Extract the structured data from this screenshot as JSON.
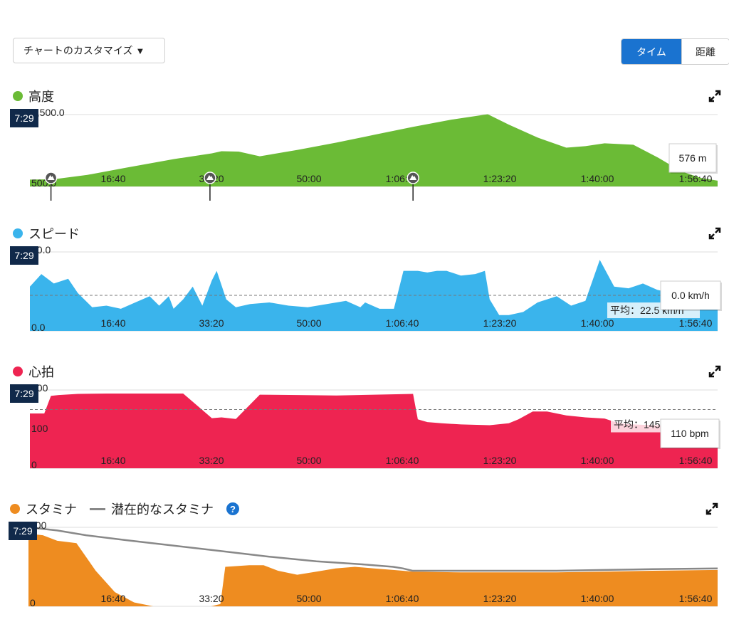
{
  "toolbar": {
    "customize_label": "チャートのカスタマイズ",
    "customize_arrow": "▼",
    "toggle_time": "タイム",
    "toggle_distance": "距離"
  },
  "icons": {
    "expand": "expand-icon",
    "help": "help-icon",
    "summit": "summit-marker-icon"
  },
  "chart_data": [
    {
      "id": "elevation",
      "title": "高度",
      "type": "area",
      "color": "#6bbb36",
      "cursor_label": "7:29",
      "ylim": [
        500,
        1500
      ],
      "y_tick_labels": [
        "1,500.0",
        "500.0"
      ],
      "x_tick_labels": [
        "16:40",
        "33:20",
        "50:00",
        "1:06:40",
        "1:23:20",
        "1:40:00",
        "1:56:40"
      ],
      "x_unit": "seconds",
      "xlim": [
        0,
        7180
      ],
      "x": [
        0,
        250,
        600,
        1000,
        1500,
        1900,
        2000,
        2180,
        2400,
        2800,
        3200,
        3600,
        4000,
        4400,
        4780,
        5000,
        5300,
        5600,
        5800,
        6000,
        6300,
        6560,
        6800,
        7000,
        7180
      ],
      "values": [
        595,
        600,
        660,
        760,
        880,
        960,
        990,
        985,
        920,
        1010,
        1110,
        1220,
        1330,
        1430,
        1505,
        1360,
        1180,
        1040,
        1060,
        1100,
        1080,
        900,
        710,
        620,
        580
      ],
      "markers_x": [
        220,
        1880,
        4000
      ],
      "tooltip": "576 m"
    },
    {
      "id": "speed",
      "title": "スピード",
      "type": "area",
      "color": "#3ab4ec",
      "cursor_label": "7:29",
      "ylim": [
        0,
        50
      ],
      "y_tick_labels": [
        "50.0",
        "0.0"
      ],
      "x_tick_labels": [
        "16:40",
        "33:20",
        "50:00",
        "1:06:40",
        "1:23:20",
        "1:40:00",
        "1:56:40"
      ],
      "x_unit": "seconds",
      "xlim": [
        0,
        7180
      ],
      "x": [
        0,
        120,
        250,
        400,
        500,
        650,
        800,
        950,
        1100,
        1250,
        1350,
        1450,
        1500,
        1600,
        1700,
        1800,
        1900,
        1950,
        2050,
        2150,
        2300,
        2500,
        2700,
        2900,
        3100,
        3300,
        3450,
        3500,
        3650,
        3800,
        3900,
        4000,
        4050,
        4150,
        4250,
        4350,
        4500,
        4650,
        4750,
        4800,
        4900,
        5000,
        5150,
        5300,
        5500,
        5650,
        5800,
        5950,
        6100,
        6250,
        6400,
        6550,
        6700,
        6900,
        7050,
        7180
      ],
      "values": [
        28,
        36,
        30,
        33,
        24,
        15,
        16,
        14,
        18,
        22,
        16,
        22,
        14,
        20,
        28,
        16,
        32,
        38,
        20,
        15,
        17,
        18,
        16,
        15,
        17,
        19,
        15,
        18,
        14,
        14,
        38,
        38,
        38,
        37,
        38,
        38,
        35,
        36,
        38,
        20,
        10,
        10,
        12,
        18,
        22,
        16,
        19,
        45,
        28,
        27,
        30,
        26,
        24,
        28,
        24,
        14
      ],
      "avg_line": 22.5,
      "avg_label": "平均：22.5 km/h",
      "tooltip": "0.0 km/h"
    },
    {
      "id": "heart_rate",
      "title": "心拍",
      "type": "area",
      "color": "#ee2451",
      "cursor_label": "7:29",
      "ylim": [
        0,
        200
      ],
      "y_tick_labels": [
        "200",
        "100",
        "0"
      ],
      "x_tick_labels": [
        "16:40",
        "33:20",
        "50:00",
        "1:06:40",
        "1:23:20",
        "1:40:00",
        "1:56:40"
      ],
      "x_unit": "seconds",
      "xlim": [
        0,
        7180
      ],
      "x": [
        0,
        150,
        220,
        300,
        500,
        800,
        1200,
        1600,
        1700,
        1900,
        2000,
        2150,
        2400,
        2800,
        3200,
        3600,
        4000,
        4050,
        4150,
        4300,
        4500,
        4800,
        5000,
        5100,
        5250,
        5400,
        5600,
        5800,
        6000,
        6150,
        6300,
        6500,
        6800,
        7000,
        7180
      ],
      "values": [
        140,
        140,
        185,
        187,
        190,
        191,
        191,
        191,
        170,
        128,
        130,
        126,
        188,
        187,
        186,
        188,
        190,
        125,
        118,
        115,
        112,
        110,
        115,
        125,
        145,
        145,
        135,
        130,
        127,
        115,
        112,
        110,
        108,
        108,
        108
      ],
      "avg_line": 150,
      "avg_label": "平均：145 bpm",
      "tooltip": "110 bpm"
    },
    {
      "id": "stamina",
      "title": "スタミナ",
      "secondary_title": "潜在的なスタミナ",
      "type": "area",
      "color": "#ee8c20",
      "secondary_color": "#888888",
      "cursor_label": "7:29",
      "ylim": [
        0,
        100
      ],
      "y_tick_labels": [
        "100",
        "0"
      ],
      "x_tick_labels": [
        "16:40",
        "33:20",
        "50:00",
        "1:06:40",
        "1:23:20",
        "1:40:00",
        "1:56:40"
      ],
      "x_unit": "seconds",
      "xlim": [
        0,
        7180
      ],
      "x": [
        0,
        150,
        300,
        500,
        700,
        900,
        1100,
        1300,
        1600,
        1900,
        2000,
        2050,
        2300,
        2450,
        2600,
        2800,
        3000,
        3200,
        3400,
        3600,
        3800,
        3900,
        4000,
        4500,
        5000,
        5500,
        6000,
        6500,
        7180
      ],
      "values": [
        92,
        90,
        83,
        80,
        45,
        18,
        5,
        0,
        0,
        0,
        3,
        50,
        52,
        52,
        45,
        40,
        44,
        48,
        50,
        48,
        46,
        45,
        44,
        43,
        43,
        43,
        44,
        45,
        46
      ],
      "secondary_x": [
        0,
        300,
        600,
        1000,
        1500,
        2000,
        2500,
        3000,
        3500,
        3800,
        3900,
        4000,
        4500,
        5000,
        5500,
        6000,
        6500,
        7180
      ],
      "secondary_values": [
        100,
        96,
        90,
        84,
        77,
        70,
        63,
        57,
        53,
        50,
        48,
        45,
        45,
        45,
        45,
        46,
        47,
        48
      ]
    }
  ]
}
